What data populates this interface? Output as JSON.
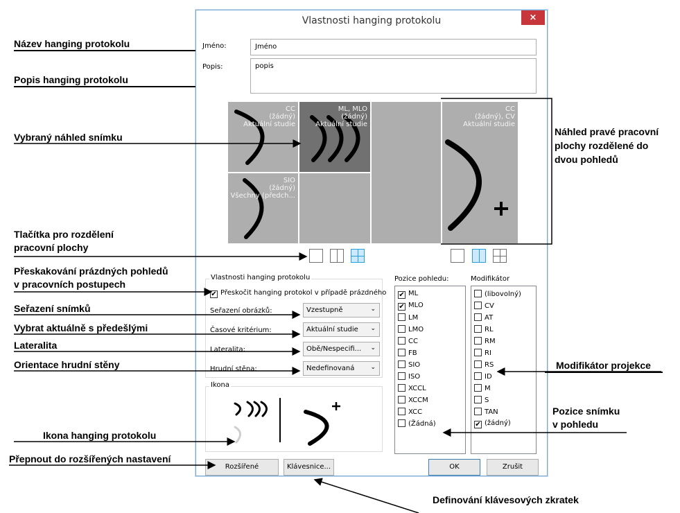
{
  "dialog": {
    "title": "Vlastnosti hanging protokolu",
    "close_symbol": "×",
    "name_label": "Jméno:",
    "name_value": "Jméno",
    "desc_label": "Popis:",
    "desc_value": "popis"
  },
  "preview": {
    "tile1": [
      "CC",
      "(žádný)",
      "Aktuální studie"
    ],
    "tile2": [
      "ML, MLO",
      "(žádný)",
      "Aktuální studie"
    ],
    "tile3": [
      "SIO",
      "(žádný)",
      "Všechny (předch..."
    ],
    "tile4": [
      "CC",
      "(žádný), CV",
      "Aktuální studie"
    ]
  },
  "properties": {
    "group_title": "Vlastnosti hanging protokolu",
    "skip_label": "Přeskočit hanging protokol v případě prázdného",
    "sort_label": "Seřazení obrázků:",
    "sort_value": "Vzestupně",
    "time_label": "Časové kritérium:",
    "time_value": "Aktuální studie",
    "laterality_label": "Lateralita:",
    "laterality_value": "Obě/Nespecifi...",
    "wall_label": "Hrudní stěna:",
    "wall_value": "Nedefinovaná",
    "dropdown_arrow": "⌄"
  },
  "icon_group": {
    "title": "Ikona"
  },
  "view_position": {
    "title": "Pozice pohledu:",
    "items": [
      "ML",
      "MLO",
      "LM",
      "LMO",
      "CC",
      "FB",
      "SIO",
      "ISO",
      "XCCL",
      "XCCM",
      "XCC",
      "(Žádná)"
    ],
    "checked": [
      true,
      true,
      false,
      false,
      false,
      false,
      false,
      false,
      false,
      false,
      false,
      false
    ]
  },
  "modifier": {
    "title": "Modifikátor",
    "items": [
      "(libovolný)",
      "CV",
      "AT",
      "RL",
      "RM",
      "RI",
      "RS",
      "ID",
      "M",
      "S",
      "TAN",
      "(žádný)"
    ],
    "checked": [
      false,
      false,
      false,
      false,
      false,
      false,
      false,
      false,
      false,
      false,
      false,
      true
    ]
  },
  "buttons": {
    "advanced": "Rozšířené",
    "keyboard": "Klávesnice...",
    "ok": "OK",
    "cancel": "Zrušit"
  },
  "annotations": {
    "a1": "Název hanging protokolu",
    "a2": "Popis hanging protokolu",
    "a3": "Vybraný náhled snímku",
    "a4a": "Náhled pravé pracovní",
    "a4b": "plochy rozdělené do",
    "a4c": "dvou pohledů",
    "a5a": "Tlačítka pro rozdělení",
    "a5b": "pracovní plochy",
    "a6a": "Přeskakování prázdných  pohledů",
    "a6b": "v pracovních postupech",
    "a7": "Seřazení snímků",
    "a8": "Vybrat aktuálně s předešlými",
    "a9": "Lateralita",
    "a10": "Orientace hrudní stěny",
    "a11": "Modifikátor projekce",
    "a12a": "Pozice snímku",
    "a12b": "v pohledu",
    "a13": "Ikona hanging protokolu",
    "a14": "Přepnout do rozšířených nastavení",
    "a15": "Definování klávesových zkratek"
  }
}
